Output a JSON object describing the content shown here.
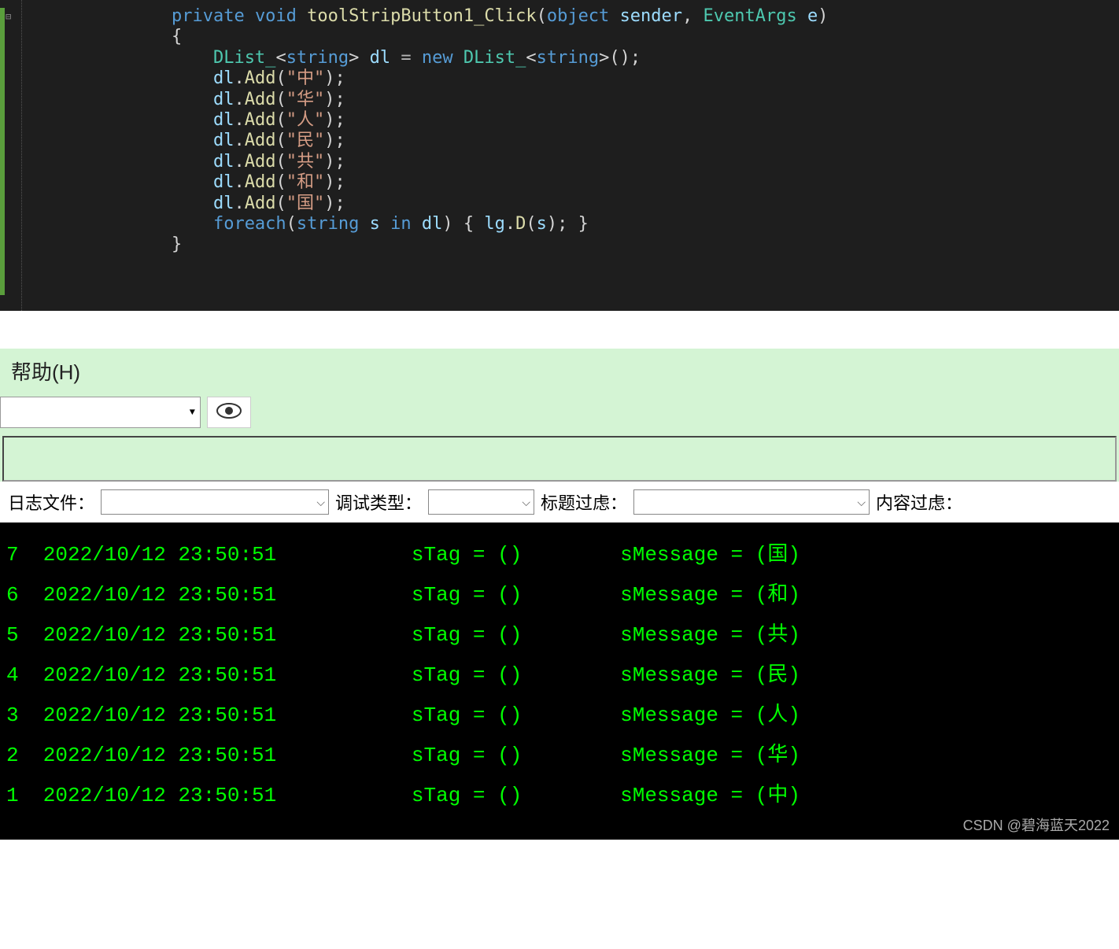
{
  "code": {
    "tokens": [
      [
        [
          "        ",
          "punct"
        ],
        [
          "private",
          "kw"
        ],
        [
          " ",
          "punct"
        ],
        [
          "void",
          "kw"
        ],
        [
          " ",
          "punct"
        ],
        [
          "toolStripButton1_Click",
          "method"
        ],
        [
          "(",
          "punct"
        ],
        [
          "object",
          "kw"
        ],
        [
          " ",
          "punct"
        ],
        [
          "sender",
          "var"
        ],
        [
          ", ",
          "punct"
        ],
        [
          "EventArgs",
          "type"
        ],
        [
          " ",
          "punct"
        ],
        [
          "e",
          "var"
        ],
        [
          ")",
          "punct"
        ]
      ],
      [
        [
          "        {",
          "punct"
        ]
      ],
      [
        [
          "            ",
          "punct"
        ],
        [
          "DList_",
          "type"
        ],
        [
          "<",
          "punct"
        ],
        [
          "string",
          "kw"
        ],
        [
          "> ",
          "punct"
        ],
        [
          "dl",
          "var"
        ],
        [
          " ",
          "punct"
        ],
        [
          "=",
          "op"
        ],
        [
          " ",
          "punct"
        ],
        [
          "new",
          "kw"
        ],
        [
          " ",
          "punct"
        ],
        [
          "DList_",
          "type"
        ],
        [
          "<",
          "punct"
        ],
        [
          "string",
          "kw"
        ],
        [
          ">();",
          "punct"
        ]
      ],
      [
        [
          "",
          "punct"
        ]
      ],
      [
        [
          "            ",
          "punct"
        ],
        [
          "dl",
          "var"
        ],
        [
          ".",
          "punct"
        ],
        [
          "Add",
          "method"
        ],
        [
          "(",
          "punct"
        ],
        [
          "\"中\"",
          "string"
        ],
        [
          ");",
          "punct"
        ]
      ],
      [
        [
          "            ",
          "punct"
        ],
        [
          "dl",
          "var"
        ],
        [
          ".",
          "punct"
        ],
        [
          "Add",
          "method"
        ],
        [
          "(",
          "punct"
        ],
        [
          "\"华\"",
          "string"
        ],
        [
          ");",
          "punct"
        ]
      ],
      [
        [
          "            ",
          "punct"
        ],
        [
          "dl",
          "var"
        ],
        [
          ".",
          "punct"
        ],
        [
          "Add",
          "method"
        ],
        [
          "(",
          "punct"
        ],
        [
          "\"人\"",
          "string"
        ],
        [
          ");",
          "punct"
        ]
      ],
      [
        [
          "            ",
          "punct"
        ],
        [
          "dl",
          "var"
        ],
        [
          ".",
          "punct"
        ],
        [
          "Add",
          "method"
        ],
        [
          "(",
          "punct"
        ],
        [
          "\"民\"",
          "string"
        ],
        [
          ");",
          "punct"
        ]
      ],
      [
        [
          "            ",
          "punct"
        ],
        [
          "dl",
          "var"
        ],
        [
          ".",
          "punct"
        ],
        [
          "Add",
          "method"
        ],
        [
          "(",
          "punct"
        ],
        [
          "\"共\"",
          "string"
        ],
        [
          ");",
          "punct"
        ]
      ],
      [
        [
          "            ",
          "punct"
        ],
        [
          "dl",
          "var"
        ],
        [
          ".",
          "punct"
        ],
        [
          "Add",
          "method"
        ],
        [
          "(",
          "punct"
        ],
        [
          "\"和\"",
          "string"
        ],
        [
          ");",
          "punct"
        ]
      ],
      [
        [
          "            ",
          "punct"
        ],
        [
          "dl",
          "var"
        ],
        [
          ".",
          "punct"
        ],
        [
          "Add",
          "method"
        ],
        [
          "(",
          "punct"
        ],
        [
          "\"国\"",
          "string"
        ],
        [
          ");",
          "punct"
        ]
      ],
      [
        [
          "",
          "punct"
        ]
      ],
      [
        [
          "            ",
          "punct"
        ],
        [
          "foreach",
          "kw"
        ],
        [
          "(",
          "punct"
        ],
        [
          "string",
          "kw"
        ],
        [
          " ",
          "punct"
        ],
        [
          "s",
          "var"
        ],
        [
          " ",
          "punct"
        ],
        [
          "in",
          "kw"
        ],
        [
          " ",
          "punct"
        ],
        [
          "dl",
          "var"
        ],
        [
          ") { ",
          "punct"
        ],
        [
          "lg",
          "var"
        ],
        [
          ".",
          "punct"
        ],
        [
          "D",
          "method"
        ],
        [
          "(",
          "punct"
        ],
        [
          "s",
          "var"
        ],
        [
          "); }",
          "punct"
        ]
      ],
      [
        [
          "        }",
          "punct"
        ]
      ]
    ]
  },
  "help": {
    "menu_label": "帮助(H)",
    "filters": {
      "log_file": "日志文件：",
      "debug_type": "调试类型：",
      "title_filter": "标题过虑：",
      "content_filter": "内容过虑："
    }
  },
  "log": {
    "rows": [
      {
        "n": "7",
        "ts": "2022/10/12 23:50:51",
        "tag": "sTag = ()",
        "msg": "sMessage = (国)"
      },
      {
        "n": "6",
        "ts": "2022/10/12 23:50:51",
        "tag": "sTag = ()",
        "msg": "sMessage = (和)"
      },
      {
        "n": "5",
        "ts": "2022/10/12 23:50:51",
        "tag": "sTag = ()",
        "msg": "sMessage = (共)"
      },
      {
        "n": "4",
        "ts": "2022/10/12 23:50:51",
        "tag": "sTag = ()",
        "msg": "sMessage = (民)"
      },
      {
        "n": "3",
        "ts": "2022/10/12 23:50:51",
        "tag": "sTag = ()",
        "msg": "sMessage = (人)"
      },
      {
        "n": "2",
        "ts": "2022/10/12 23:50:51",
        "tag": "sTag = ()",
        "msg": "sMessage = (华)"
      },
      {
        "n": "1",
        "ts": "2022/10/12 23:50:51",
        "tag": "sTag = ()",
        "msg": "sMessage = (中)"
      }
    ]
  },
  "watermark": "CSDN @碧海蓝天2022"
}
